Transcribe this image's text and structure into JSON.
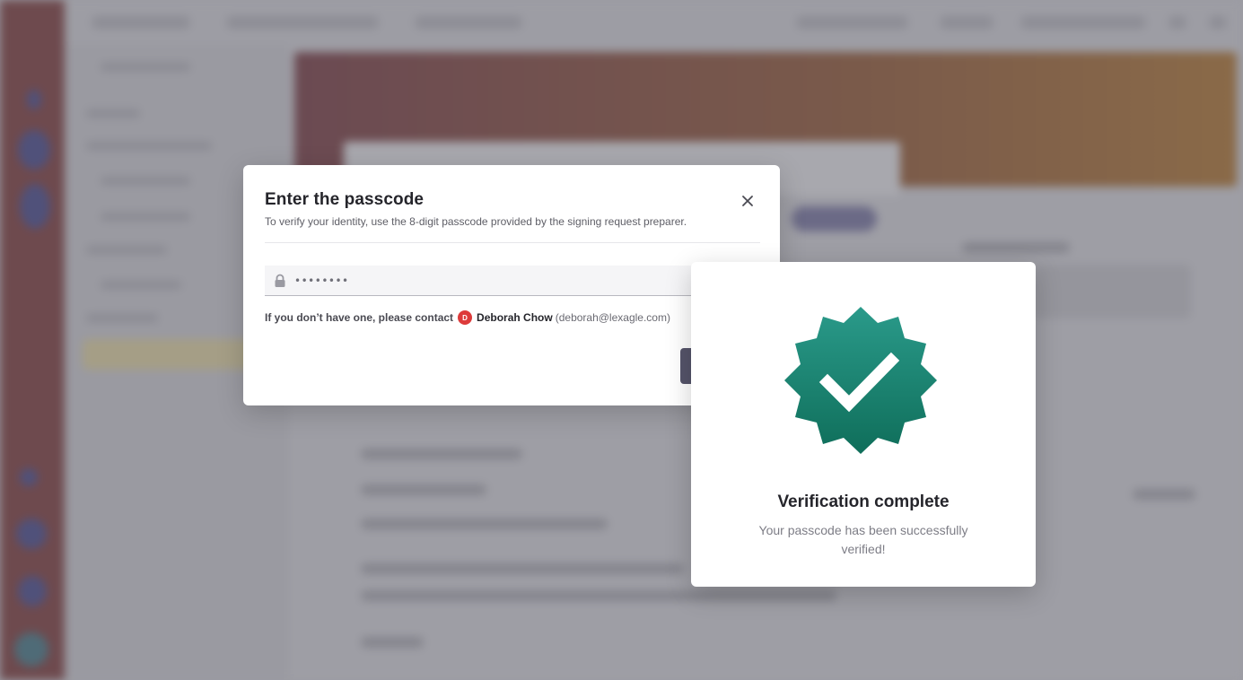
{
  "passcode_dialog": {
    "title": "Enter the passcode",
    "subtitle": "To verify your identity, use the 8-digit passcode provided by the signing request preparer.",
    "passcode_value": "••••••••",
    "contact_lead": "If you don’t have one, please contact",
    "contact_initial": "D",
    "contact_name": "Deborah Chow",
    "contact_email": "(deborah@lexagle.com)"
  },
  "verification": {
    "title": "Verification complete",
    "message": "Your passcode has been successfully verified!"
  },
  "icons": {
    "lock": "lock-icon",
    "close": "close-icon",
    "badge": "verified-badge-icon"
  },
  "colors": {
    "badge_top": "#2a9a8a",
    "badge_bottom": "#0f6e5a",
    "avatar": "#dd3b3b"
  }
}
